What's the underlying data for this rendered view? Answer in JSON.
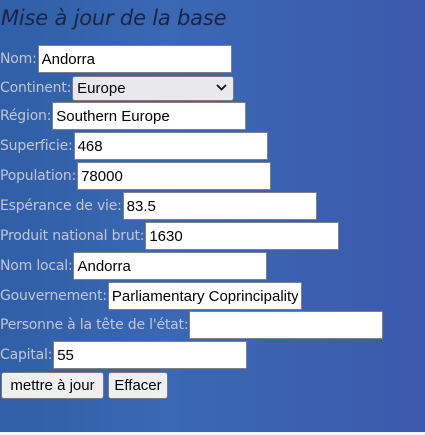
{
  "form": {
    "title": "Mise à jour de la base",
    "fields": {
      "nom": {
        "label": "Nom:",
        "value": "Andorra"
      },
      "continent": {
        "label": "Continent:",
        "value": "Europe"
      },
      "region": {
        "label": "Région:",
        "value": "Southern Europe"
      },
      "superficie": {
        "label": "Superficie:",
        "value": "468"
      },
      "population": {
        "label": "Population:",
        "value": "78000"
      },
      "esperance": {
        "label": "Espérance de vie:",
        "value": "83.5"
      },
      "pnb": {
        "label": "Produit national brut:",
        "value": "1630"
      },
      "nom_local": {
        "label": "Nom local:",
        "value": "Andorra"
      },
      "gouvernement": {
        "label": "Gouvernement:",
        "value": "Parliamentary Coprincipality"
      },
      "chef": {
        "label": "Personne à la tête de l'état:",
        "value": ""
      },
      "capital": {
        "label": "Capital:",
        "value": "55"
      }
    },
    "buttons": {
      "update": "mettre à jour",
      "reset": "Effacer"
    }
  }
}
